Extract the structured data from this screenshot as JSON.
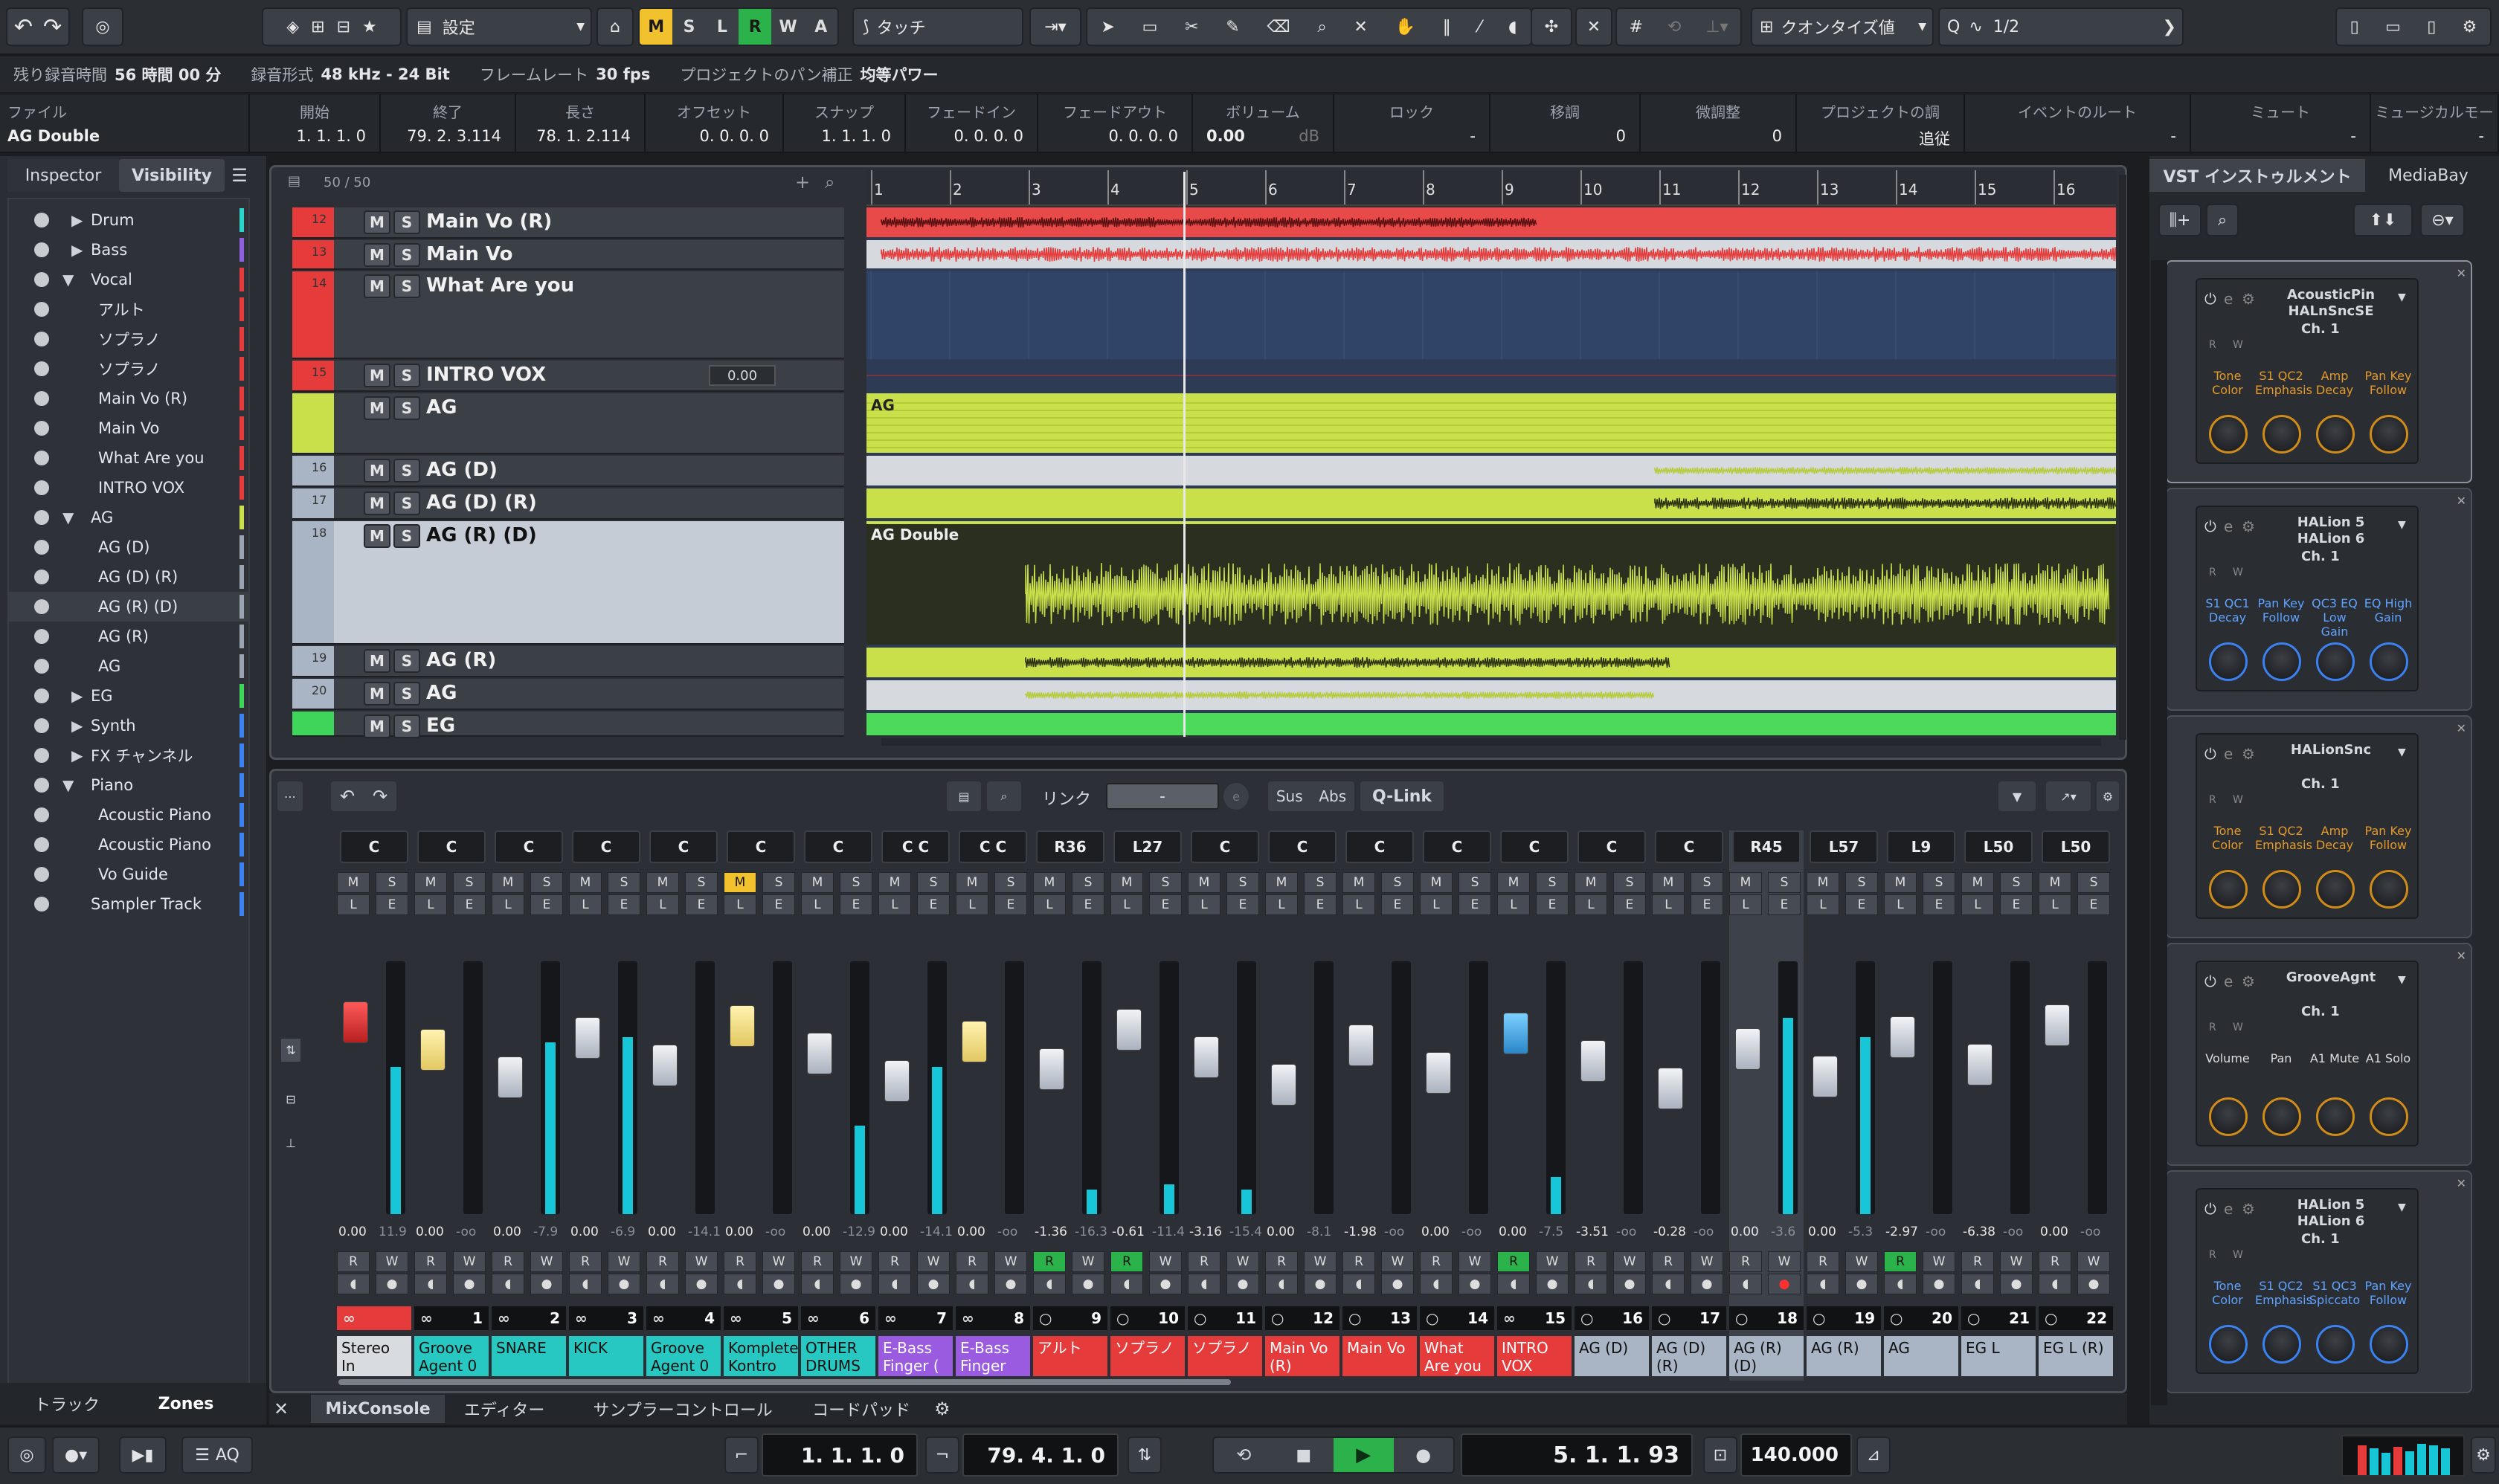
{
  "toolbar": {
    "preset_label": "設定",
    "mode_letters": [
      "M",
      "S",
      "L",
      "R",
      "W",
      "A"
    ],
    "automation_mode": "タッチ",
    "quantize_label": "クオンタイズ値",
    "quantize_value": "1/2"
  },
  "status": [
    {
      "label": "残り録音時間",
      "value": "56 時間 00 分"
    },
    {
      "label": "録音形式",
      "value": "48 kHz - 24 Bit"
    },
    {
      "label": "フレームレート",
      "value": "30 fps"
    },
    {
      "label": "プロジェクトのパン補正",
      "value": "均等パワー"
    }
  ],
  "infoline": {
    "file_label": "ファイル",
    "file_value": "AG Double",
    "cols": [
      {
        "h": "開始",
        "v": "1. 1. 1.   0"
      },
      {
        "h": "終了",
        "v": "79. 2. 3.114"
      },
      {
        "h": "長さ",
        "v": "78. 1. 2.114"
      },
      {
        "h": "オフセット",
        "v": "0. 0. 0.   0"
      },
      {
        "h": "スナップ",
        "v": "1. 1. 1.   0"
      },
      {
        "h": "フェードイン",
        "v": "0. 0. 0.   0"
      },
      {
        "h": "フェードアウト",
        "v": "0. 0. 0.   0"
      },
      {
        "h": "ボリューム",
        "v": "0.00"
      },
      {
        "h": "ロック",
        "v": "-"
      },
      {
        "h": "移調",
        "v": "0"
      },
      {
        "h": "微調整",
        "v": "0"
      },
      {
        "h": "プロジェクトの調",
        "v": "追従"
      },
      {
        "h": "イベントのルート",
        "v": "-"
      },
      {
        "h": "ミュート",
        "v": "-"
      },
      {
        "h": "ミュージカルモー",
        "v": "-"
      }
    ],
    "volume_unit": "dB"
  },
  "left_panel": {
    "tabs": [
      "Inspector",
      "Visibility"
    ],
    "items": [
      {
        "label": "Drum",
        "indent": 1,
        "expander": "closed",
        "color": "#2ad3c9"
      },
      {
        "label": "Bass",
        "indent": 1,
        "expander": "closed",
        "color": "#8f5fe0"
      },
      {
        "label": "Vocal",
        "indent": 1,
        "expander": "open",
        "color": "#e53b3b"
      },
      {
        "label": "アルト",
        "indent": 2,
        "color": "#e53b3b"
      },
      {
        "label": "ソプラノ",
        "indent": 2,
        "color": "#e53b3b"
      },
      {
        "label": "ソプラノ",
        "indent": 2,
        "color": "#e53b3b"
      },
      {
        "label": "Main Vo (R)",
        "indent": 2,
        "color": "#e53b3b"
      },
      {
        "label": "Main Vo",
        "indent": 2,
        "color": "#e53b3b"
      },
      {
        "label": "What Are you",
        "indent": 2,
        "color": "#e53b3b"
      },
      {
        "label": "INTRO VOX",
        "indent": 2,
        "color": "#e53b3b"
      },
      {
        "label": "AG",
        "indent": 1,
        "expander": "open",
        "color": "#c9e04a"
      },
      {
        "label": "AG (D)",
        "indent": 2,
        "color": "#9aa3b0"
      },
      {
        "label": "AG (D) (R)",
        "indent": 2,
        "color": "#9aa3b0"
      },
      {
        "label": "AG (R) (D)",
        "indent": 2,
        "color": "#9aa3b0"
      },
      {
        "label": "AG (R)",
        "indent": 2,
        "color": "#9aa3b0"
      },
      {
        "label": "AG",
        "indent": 2,
        "color": "#9aa3b0"
      },
      {
        "label": "EG",
        "indent": 1,
        "expander": "closed",
        "color": "#3fd45a"
      },
      {
        "label": "Synth",
        "indent": 1,
        "expander": "closed",
        "color": "#3b82f0"
      },
      {
        "label": "FX チャンネル",
        "indent": 1,
        "expander": "closed",
        "color": "#3b82f0"
      },
      {
        "label": "Piano",
        "indent": 1,
        "expander": "open",
        "color": "#3b82f0"
      },
      {
        "label": "Acoustic Piano",
        "indent": 2,
        "color": "#3b82f0"
      },
      {
        "label": "Acoustic Piano",
        "indent": 2,
        "color": "#3b82f0"
      },
      {
        "label": "Vo Guide",
        "indent": 2,
        "color": "#3b82f0"
      },
      {
        "label": "Sampler Track",
        "indent": 1,
        "color": "#3b82f0"
      }
    ],
    "bottom_tabs": [
      "トラック",
      "Zones"
    ]
  },
  "project": {
    "track_count": "50 / 50",
    "ruler": [
      "1",
      "2",
      "3",
      "4",
      "5",
      "6",
      "7",
      "8",
      "9",
      "10",
      "11",
      "12",
      "13",
      "14",
      "15",
      "16"
    ],
    "tracks": [
      {
        "num": "12",
        "name": "Main Vo (R)"
      },
      {
        "num": "13",
        "name": "Main Vo"
      },
      {
        "num": "14",
        "name": "What Are you"
      },
      {
        "num": "15",
        "name": "INTRO VOX",
        "value": "0.00"
      },
      {
        "num": "",
        "name": "AG"
      },
      {
        "num": "16",
        "name": "AG (D)"
      },
      {
        "num": "17",
        "name": "AG (D) (R)"
      },
      {
        "num": "18",
        "name": "AG (R) (D)"
      },
      {
        "num": "19",
        "name": "AG (R)"
      },
      {
        "num": "20",
        "name": "AG"
      },
      {
        "num": "",
        "name": "EG"
      }
    ],
    "events": {
      "ag_folder": "AG",
      "ag_double": "AG Double"
    },
    "ms": [
      "M",
      "S"
    ]
  },
  "mixer": {
    "link_label": "リンク",
    "link_value": "-",
    "buttons": [
      "Sus",
      "Abs",
      "Q-Link"
    ],
    "channels": [
      {
        "pan": "C",
        "vol": "0.00",
        "peak": "11.9",
        "num": "",
        "label": "Stereo In",
        "color": "#d8dbe0",
        "rw": "",
        "cap": "red",
        "meter": 0.6
      },
      {
        "pan": "C",
        "vol": "0.00",
        "peak": "-oo",
        "num": "1",
        "label": "Groove Agent 0",
        "color": "#27c7c2",
        "rw": "",
        "cap": "yellow",
        "meter": 0
      },
      {
        "pan": "C",
        "vol": "0.00",
        "peak": "-7.9",
        "num": "2",
        "label": "SNARE",
        "color": "#27c7c2",
        "rw": "",
        "cap": "white",
        "meter": 0.7
      },
      {
        "pan": "C",
        "vol": "0.00",
        "peak": "-6.9",
        "num": "3",
        "label": "KICK",
        "color": "#27c7c2",
        "rw": "",
        "cap": "white",
        "meter": 0.72
      },
      {
        "pan": "C",
        "vol": "0.00",
        "peak": "-14.1",
        "num": "4",
        "label": "Groove Agent 0",
        "color": "#27c7c2",
        "rw": "",
        "cap": "white",
        "meter": 0
      },
      {
        "pan": "C",
        "vol": "0.00",
        "peak": "-oo",
        "num": "5",
        "label": "Komplete Kontro",
        "color": "#27c7c2",
        "rw": "",
        "cap": "yellow",
        "meter": 0,
        "mute": true
      },
      {
        "pan": "C",
        "vol": "0.00",
        "peak": "-12.9",
        "num": "6",
        "label": "OTHER DRUMS",
        "color": "#27c7c2",
        "rw": "",
        "cap": "white",
        "meter": 0.36
      },
      {
        "pan": "C C",
        "vol": "0.00",
        "peak": "-14.1",
        "num": "7",
        "label": "E-Bass Finger (",
        "color": "#9b5be0",
        "rw": "",
        "cap": "white",
        "meter": 0.6
      },
      {
        "pan": "C C",
        "vol": "0.00",
        "peak": "-oo",
        "num": "8",
        "label": "E-Bass Finger",
        "color": "#9b5be0",
        "rw": "",
        "cap": "yellow",
        "meter": 0
      },
      {
        "pan": "R36",
        "vol": "-1.36",
        "peak": "-16.3",
        "num": "9",
        "label": "アルト",
        "color": "#e53b3b",
        "rw": "R",
        "cap": "white",
        "meter": 0.1
      },
      {
        "pan": "L27",
        "vol": "-0.61",
        "peak": "-11.4",
        "num": "10",
        "label": "ソプラノ",
        "color": "#e53b3b",
        "rw": "R",
        "cap": "white",
        "meter": 0.12
      },
      {
        "pan": "C",
        "vol": "-3.16",
        "peak": "-15.4",
        "num": "11",
        "label": "ソプラノ",
        "color": "#e53b3b",
        "rw": "",
        "cap": "white",
        "meter": 0.1
      },
      {
        "pan": "C",
        "vol": "0.00",
        "peak": "-8.1",
        "num": "12",
        "label": "Main Vo (R)",
        "color": "#e53b3b",
        "rw": "",
        "cap": "white",
        "meter": 0
      },
      {
        "pan": "C",
        "vol": "-1.98",
        "peak": "-oo",
        "num": "13",
        "label": "Main Vo",
        "color": "#e53b3b",
        "rw": "",
        "cap": "white",
        "meter": 0
      },
      {
        "pan": "C",
        "vol": "0.00",
        "peak": "-oo",
        "num": "14",
        "label": "What Are you",
        "color": "#e53b3b",
        "rw": "",
        "cap": "white",
        "meter": 0
      },
      {
        "pan": "C",
        "vol": "0.00",
        "peak": "-7.5",
        "num": "15",
        "label": "INTRO VOX",
        "color": "#e53b3b",
        "rw": "R",
        "cap": "blue",
        "meter": 0.15
      },
      {
        "pan": "C",
        "vol": "-3.51",
        "peak": "-oo",
        "num": "16",
        "label": "AG (D)",
        "color": "#a9b4c4",
        "rw": "",
        "cap": "white",
        "meter": 0
      },
      {
        "pan": "C",
        "vol": "-0.28",
        "peak": "-oo",
        "num": "17",
        "label": "AG (D) (R)",
        "color": "#a9b4c4",
        "rw": "",
        "cap": "white",
        "meter": 0
      },
      {
        "pan": "R45",
        "vol": "0.00",
        "peak": "-3.6",
        "num": "18",
        "label": "AG (R) (D)",
        "color": "#a9b4c4",
        "rw": "",
        "cap": "white",
        "meter": 0.8,
        "selected": true
      },
      {
        "pan": "L57",
        "vol": "0.00",
        "peak": "-5.3",
        "num": "19",
        "label": "AG (R)",
        "color": "#a9b4c4",
        "rw": "",
        "cap": "white",
        "meter": 0.72
      },
      {
        "pan": "L9",
        "vol": "-2.97",
        "peak": "-oo",
        "num": "20",
        "label": "AG",
        "color": "#a9b4c4",
        "rw": "R",
        "cap": "white",
        "meter": 0
      },
      {
        "pan": "L50",
        "vol": "-6.38",
        "peak": "-oo",
        "num": "21",
        "label": "EG L",
        "color": "#a9b4c4",
        "rw": "",
        "cap": "white",
        "meter": 0
      },
      {
        "pan": "L50",
        "vol": "0.00",
        "peak": "-oo",
        "num": "22",
        "label": "EG L (R)",
        "color": "#a9b4c4",
        "rw": "",
        "cap": "white",
        "meter": 0
      }
    ],
    "bottom_tabs": [
      "MixConsole",
      "エディター",
      "サンプラーコントロール",
      "コードパッド"
    ]
  },
  "right_panel": {
    "tabs": [
      "VST インストゥルメント",
      "MediaBay"
    ],
    "slots": [
      {
        "idx": "3",
        "name": "AcousticPin HALnSncSE",
        "ch": "Ch. 1",
        "params": [
          "Tone Color",
          "S1 QC2 Emphasis",
          "Amp Decay",
          "Pan Key Follow"
        ],
        "param_color": "orange"
      },
      {
        "idx": "4",
        "name": "HALion 5 HALion 6",
        "ch": "Ch. 1",
        "params": [
          "S1 QC1 Decay",
          "Pan Key Follow",
          "QC3 EQ Low Gain",
          "EQ High Gain"
        ],
        "param_color": "blue"
      },
      {
        "idx": "5",
        "name": "HALionSnc",
        "ch": "Ch. 1",
        "params": [
          "Tone Color",
          "S1 QC2 Emphasis",
          "Amp Decay",
          "Pan Key Follow"
        ],
        "param_color": "orange"
      },
      {
        "idx": "6",
        "name": "GrooveAgnt",
        "ch": "Ch. 1",
        "params": [
          "Volume",
          "Pan",
          "A1 Mute",
          "A1 Solo"
        ],
        "param_color": "white"
      },
      {
        "idx": "7",
        "name": "HALion 5 HALion 6",
        "ch": "Ch. 1",
        "params": [
          "Tone Color",
          "S1 QC2 Emphasis",
          "S1 QC3 Spiccato",
          "Pan Key Follow"
        ],
        "param_color": "blue"
      }
    ]
  },
  "transport": {
    "left_locator": "1. 1. 1.   0",
    "right_locator": "79. 4. 1.   0",
    "position": "5. 1. 1.  93",
    "tempo": "140.000",
    "aq": "AQ"
  }
}
